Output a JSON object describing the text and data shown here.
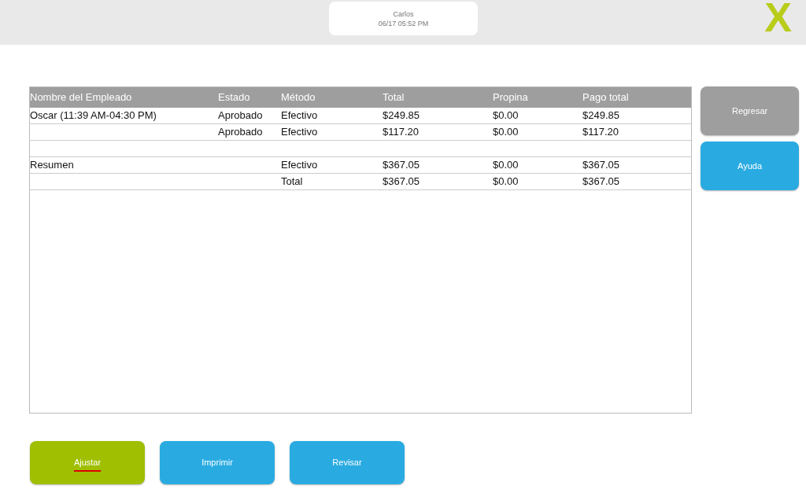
{
  "header": {
    "user": "Carlos",
    "datetime": "06/17 05:52 PM",
    "logo": "X"
  },
  "table": {
    "columns": [
      "Nombre del Empleado",
      "Estado",
      "Método",
      "Total",
      "Propina",
      "Pago total"
    ],
    "rows": [
      [
        "Oscar (11:39 AM-04:30 PM)",
        "Aprobado",
        "Efectivo",
        "$249.85",
        "$0.00",
        "$249.85"
      ],
      [
        null,
        "Aprobado",
        "Efectivo",
        "$117.20",
        "$0.00",
        "$117.20"
      ],
      [
        null,
        null,
        null,
        null,
        null,
        null
      ],
      [
        "Resumen",
        null,
        "Efectivo",
        "$367.05",
        "$0.00",
        "$367.05"
      ],
      [
        null,
        null,
        "Total",
        "$367.05",
        "$0.00",
        "$367.05"
      ]
    ]
  },
  "side_buttons": [
    {
      "label": "Regresar",
      "color": "#9e9e9e"
    },
    {
      "label": "Ayuda",
      "color": "#29abe2"
    }
  ],
  "bottom_buttons": [
    {
      "label": "Ajustar",
      "color": "#9fbf00",
      "underlined": true
    },
    {
      "label": "Imprimir",
      "color": "#29abe2",
      "underlined": false
    },
    {
      "label": "Revisar",
      "color": "#29abe2",
      "underlined": false
    }
  ]
}
